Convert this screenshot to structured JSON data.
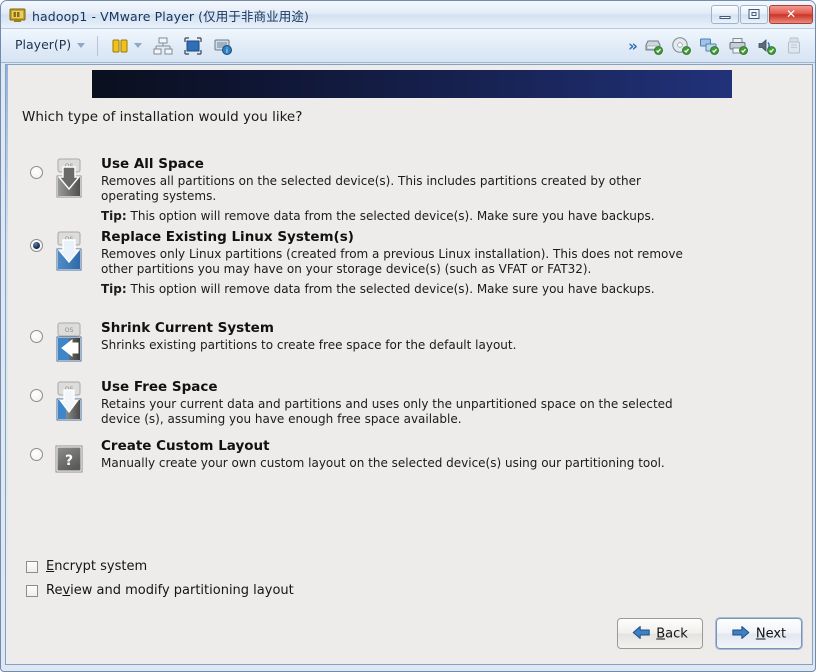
{
  "window": {
    "title": "hadoop1 - VMware Player (仅用于非商业用途)",
    "icon": "vmware-app-icon",
    "controls": {
      "minimize": "minimize-button",
      "maximize": "maximize-button",
      "close_glyph": "✕"
    }
  },
  "toolbar": {
    "player_menu_label": "Player(P)",
    "left_icons": [
      {
        "name": "pause-icon"
      },
      {
        "name": "snapshot-icon"
      },
      {
        "name": "unity-icon"
      },
      {
        "name": "fullscreen-icon"
      }
    ],
    "right_icons": [
      {
        "name": "chevron-double-right-icon",
        "glyph": "»"
      },
      {
        "name": "hard-disk-icon"
      },
      {
        "name": "cd-dvd-icon"
      },
      {
        "name": "network-adapter-icon"
      },
      {
        "name": "printer-icon"
      },
      {
        "name": "sound-card-icon"
      },
      {
        "name": "usb-device-icon"
      }
    ]
  },
  "installer": {
    "question": "Which type of installation would you like?",
    "options": [
      {
        "id": "use-all-space",
        "title": "Use All Space",
        "description": "Removes all partitions on the selected device(s).  This includes partitions created by other operating systems.",
        "tip_label": "Tip:",
        "tip_text": " This option will remove data from the selected device(s).  Make sure you have backups.",
        "selected": false,
        "icon": "disk-all-space-icon"
      },
      {
        "id": "replace-existing-linux",
        "title": "Replace Existing Linux System(s)",
        "description": "Removes only Linux partitions (created from a previous Linux installation).  This does not remove other partitions you may have on your storage device(s) (such as VFAT or FAT32).",
        "tip_label": "Tip:",
        "tip_text": " This option will remove data from the selected device(s).  Make sure you have backups.",
        "selected": true,
        "icon": "disk-replace-linux-icon"
      },
      {
        "id": "shrink-current-system",
        "title": "Shrink Current System",
        "description": "Shrinks existing partitions to create free space for the default layout.",
        "tip_label": "",
        "tip_text": "",
        "selected": false,
        "icon": "disk-shrink-icon"
      },
      {
        "id": "use-free-space",
        "title": "Use Free Space",
        "description": "Retains your current data and partitions and uses only the unpartitioned space on the selected device (s), assuming you have enough free space available.",
        "tip_label": "",
        "tip_text": "",
        "selected": false,
        "icon": "disk-free-space-icon"
      },
      {
        "id": "create-custom-layout",
        "title": "Create Custom Layout",
        "description": "Manually create your own custom layout on the selected device(s) using our partitioning tool.",
        "tip_label": "",
        "tip_text": "",
        "selected": false,
        "icon": "disk-custom-layout-icon"
      }
    ],
    "checkboxes": [
      {
        "id": "encrypt-system",
        "mnemonic": "E",
        "rest": "ncrypt system",
        "checked": false
      },
      {
        "id": "review-modify",
        "pre": "Re",
        "mnemonic": "v",
        "rest": "iew and modify partitioning layout",
        "checked": false
      }
    ],
    "buttons": {
      "back": {
        "mnemonic": "B",
        "rest": "ack",
        "icon": "arrow-left-icon",
        "focused": false
      },
      "next": {
        "mnemonic": "N",
        "rest": "ext",
        "icon": "arrow-right-icon",
        "focused": true
      }
    }
  },
  "colors": {
    "accent_blue": "#2f6fb5",
    "banner_dark": "#101737",
    "window_chrome": "#dfe7f2",
    "guest_bg": "#edecea",
    "close_red": "#cd3426"
  }
}
